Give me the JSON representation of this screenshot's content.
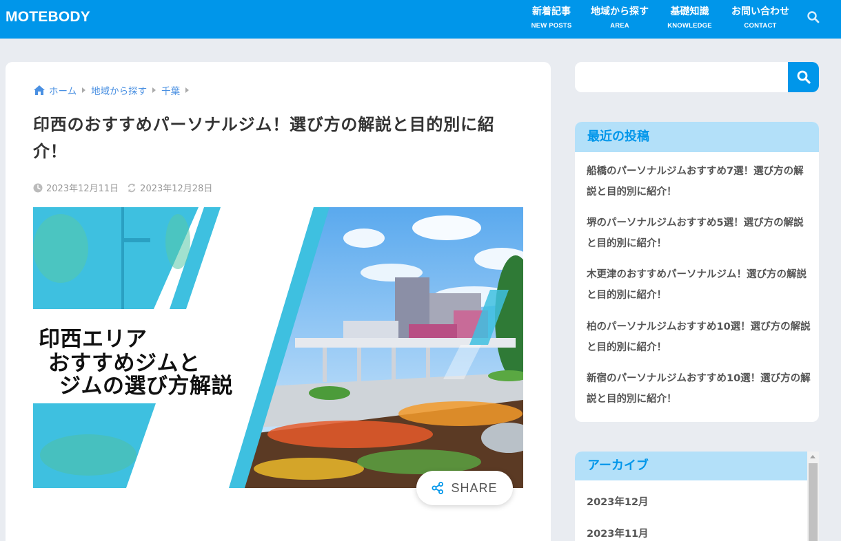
{
  "header": {
    "logo": "MOTEBODY",
    "nav": [
      {
        "jp": "新着記事",
        "en": "NEW POSTS"
      },
      {
        "jp": "地域から探す",
        "en": "AREA"
      },
      {
        "jp": "基礎知識",
        "en": "KNOWLEDGE"
      },
      {
        "jp": "お問い合わせ",
        "en": "CONTACT"
      }
    ],
    "search_icon": "search-icon"
  },
  "breadcrumb": {
    "home": "ホーム",
    "area": "地域から探す",
    "chiba": "千葉"
  },
  "article": {
    "title": "印西のおすすめパーソナルジム！選び方の解説と目的別に紹介！",
    "published": "2023年12月11日",
    "updated": "2023年12月28日",
    "hero_text": {
      "line1": "印西エリア",
      "line2": "おすすめジムと",
      "line3": "ジムの選び方解説"
    },
    "share_label": "SHARE"
  },
  "sidebar": {
    "search_placeholder": "",
    "recent": {
      "title": "最近の投稿",
      "items": [
        "船橋のパーソナルジムおすすめ7選！選び方の解説と目的別に紹介！",
        "堺のパーソナルジムおすすめ5選！選び方の解説と目的別に紹介！",
        "木更津のおすすめパーソナルジム！選び方の解説と目的別に紹介！",
        "柏のパーソナルジムおすすめ10選！選び方の解説と目的別に紹介！",
        "新宿のパーソナルジムおすすめ10選！選び方の解説と目的別に紹介！"
      ]
    },
    "archive": {
      "title": "アーカイブ",
      "items": [
        "2023年12月",
        "2023年11月"
      ]
    }
  },
  "colors": {
    "brand": "#0096ea",
    "widget_head": "#b3e0f9",
    "link": "#4a90e2"
  }
}
